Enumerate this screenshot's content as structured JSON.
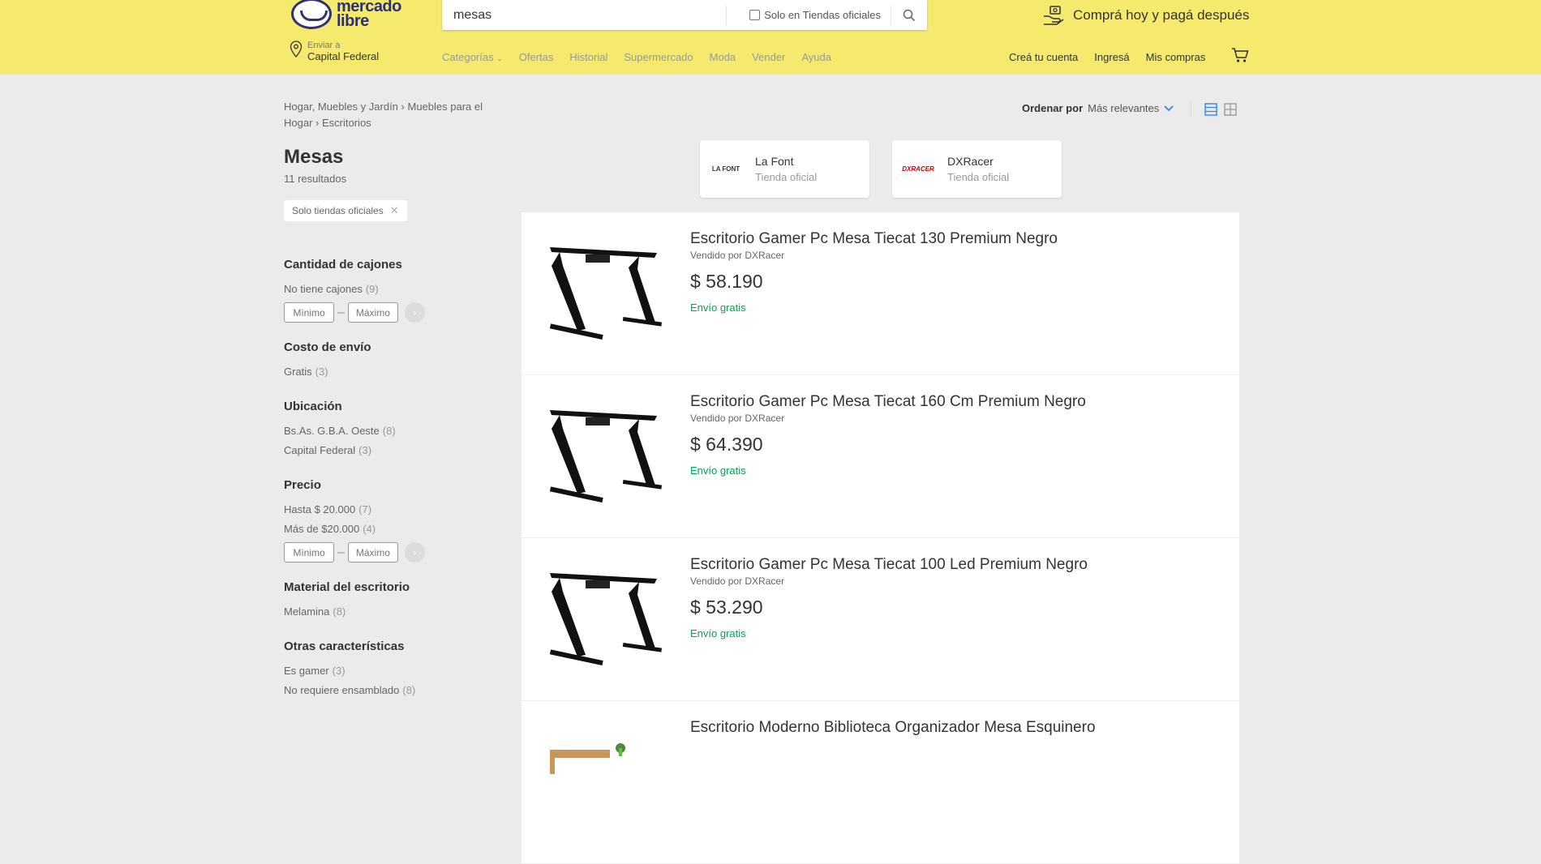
{
  "header": {
    "logo_text": "mercado libre",
    "search_value": "mesas",
    "official_stores_label": "Solo en Tiendas oficiales",
    "promo_text": "Comprá hoy y pagá después",
    "location_label": "Enviar a",
    "location_value": "Capital Federal",
    "nav": [
      "Categorías",
      "Ofertas",
      "Historial",
      "Supermercado",
      "Moda",
      "Vender",
      "Ayuda"
    ],
    "account": {
      "create": "Creá tu cuenta",
      "login": "Ingresá",
      "purchases": "Mis compras"
    },
    "colors": {
      "background": "#f5ea6e",
      "brand": "#2d3277"
    }
  },
  "breadcrumb": [
    "Hogar, Muebles y Jardín",
    "Muebles para el Hogar",
    "Escritorios"
  ],
  "page": {
    "title": "Mesas",
    "results": "11 resultados",
    "active_filter": "Solo tiendas oficiales"
  },
  "sort": {
    "label": "Ordenar por",
    "value": "Más relevantes"
  },
  "filters": [
    {
      "title": "Cantidad de cajones",
      "items": [
        {
          "label": "No tiene cajones",
          "count": "(9)"
        }
      ],
      "range": true
    },
    {
      "title": "Costo de envío",
      "items": [
        {
          "label": "Gratis",
          "count": "(3)"
        }
      ],
      "range": false
    },
    {
      "title": "Ubicación",
      "items": [
        {
          "label": "Bs.As. G.B.A. Oeste",
          "count": "(8)"
        },
        {
          "label": "Capital Federal",
          "count": "(3)"
        }
      ],
      "range": false
    },
    {
      "title": "Precio",
      "items": [
        {
          "label": "Hasta $ 20.000",
          "count": "(7)"
        },
        {
          "label": "Más de $20.000",
          "count": "(4)"
        }
      ],
      "range": true
    },
    {
      "title": "Material del escritorio",
      "items": [
        {
          "label": "Melamina",
          "count": "(8)"
        }
      ],
      "range": false
    },
    {
      "title": "Otras características",
      "items": [
        {
          "label": "Es gamer",
          "count": "(3)"
        },
        {
          "label": "No requiere ensamblado",
          "count": "(8)"
        }
      ],
      "range": false
    }
  ],
  "range_placeholders": {
    "min": "Mínimo",
    "max": "Máximo"
  },
  "stores": [
    {
      "name": "La Font",
      "type": "Tienda oficial",
      "logo": "LA FONT"
    },
    {
      "name": "DXRacer",
      "type": "Tienda oficial",
      "logo": "DXRACER"
    }
  ],
  "products": [
    {
      "title": "Escritorio Gamer Pc Mesa Tiecat 130 Premium Negro",
      "seller": "Vendido por DXRacer",
      "price": "$ 58.190",
      "shipping": "Envío gratis",
      "image": "desk-gamer"
    },
    {
      "title": "Escritorio Gamer Pc Mesa Tiecat 160 Cm Premium Negro",
      "seller": "Vendido por DXRacer",
      "price": "$ 64.390",
      "shipping": "Envío gratis",
      "image": "desk-gamer"
    },
    {
      "title": "Escritorio Gamer Pc Mesa Tiecat 100 Led Premium Negro",
      "seller": "Vendido por DXRacer",
      "price": "$ 53.290",
      "shipping": "Envío gratis",
      "image": "desk-gamer"
    },
    {
      "title": "Escritorio Moderno Biblioteca Organizador Mesa Esquinero",
      "seller": "",
      "price": "",
      "shipping": "",
      "image": "desk-wood"
    }
  ]
}
